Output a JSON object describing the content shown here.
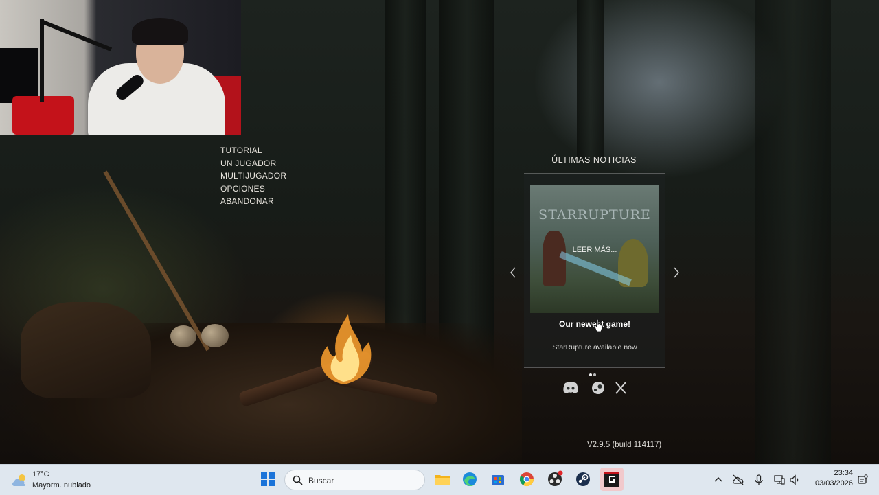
{
  "game": {
    "menu": {
      "items": [
        "TUTORIAL",
        "UN JUGADOR",
        "MULTIJUGADOR",
        "OPCIONES",
        "ABANDONAR"
      ]
    },
    "news": {
      "title": "ÚLTIMAS NOTICIAS",
      "image_logo_text": "STARRUPTURE",
      "read_more": "LEER MÁS...",
      "headline": "Our newest game!",
      "subtitle": "StarRupture available now",
      "page_count": 2,
      "active_page": 1
    },
    "social_icons": [
      "discord-icon",
      "steam-icon",
      "x-icon"
    ],
    "version": "V2.9.5 (build 114117)"
  },
  "taskbar": {
    "weather": {
      "temp": "17°C",
      "desc": "Mayorm. nublado",
      "icon": "cloudy-sun-icon"
    },
    "search_placeholder": "Buscar",
    "apps": [
      "windows-start-icon",
      "file-explorer-icon",
      "edge-icon",
      "microsoft-store-icon",
      "chrome-icon",
      "obs-icon",
      "steam-icon",
      "game-icon"
    ],
    "tray": [
      "chevron-up-icon",
      "cloud-off-icon",
      "microphone-icon",
      "network-icon",
      "volume-icon"
    ],
    "time": "23:34",
    "date": "03/03/2026"
  },
  "colors": {
    "taskbar_bg": "#dfe7ef",
    "menu_text": "#e7e3dc",
    "accent_red": "#c4121a"
  }
}
